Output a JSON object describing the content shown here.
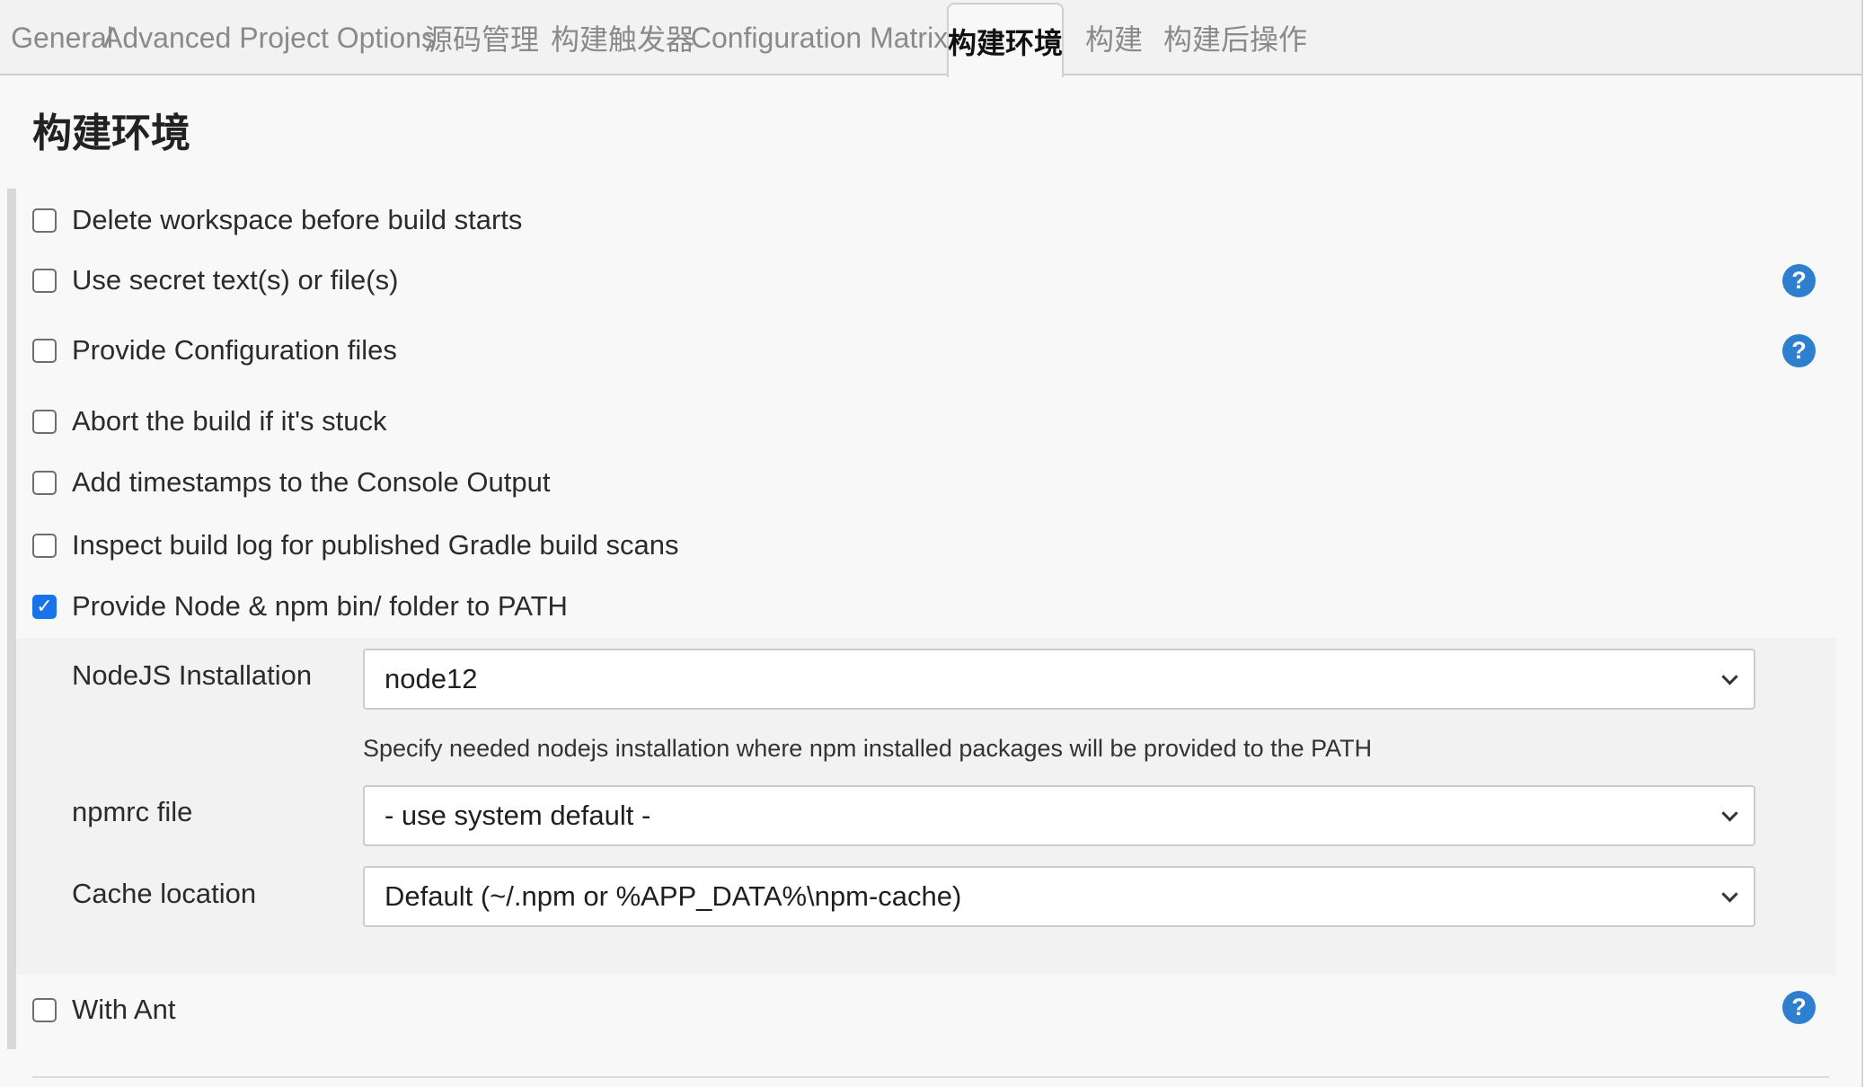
{
  "tabs": [
    {
      "label": "General"
    },
    {
      "label": "Advanced Project Options"
    },
    {
      "label": "源码管理"
    },
    {
      "label": "构建触发器"
    },
    {
      "label": "Configuration Matrix"
    },
    {
      "label": "构建环境",
      "active": true
    },
    {
      "label": "构建"
    },
    {
      "label": "构建后操作"
    }
  ],
  "section": {
    "title": "构建环境"
  },
  "options": [
    {
      "label": "Delete workspace before build starts",
      "checked": false
    },
    {
      "label": "Use secret text(s) or file(s)",
      "checked": false,
      "help": true
    },
    {
      "label": "Provide Configuration files",
      "checked": false,
      "help": true
    },
    {
      "label": "Abort the build if it's stuck",
      "checked": false
    },
    {
      "label": "Add timestamps to the Console Output",
      "checked": false
    },
    {
      "label": "Inspect build log for published Gradle build scans",
      "checked": false
    },
    {
      "label": "Provide Node & npm bin/ folder to PATH",
      "checked": true
    },
    {
      "label": "With Ant",
      "checked": false,
      "help": true
    }
  ],
  "nodejs": {
    "installation_label": "NodeJS Installation",
    "installation_value": "node12",
    "installation_hint": "Specify needed nodejs installation where npm installed packages will be provided to the PATH",
    "npmrc_label": "npmrc file",
    "npmrc_value": "- use system default -",
    "cache_label": "Cache location",
    "cache_value": "Default (~/.npm or %APP_DATA%\\npm-cache)"
  },
  "icons": {
    "help": "question-mark-help-icon",
    "dropdown": "chevron-down-icon",
    "check": "checkmark-icon"
  },
  "glyphs": {
    "help": "?",
    "check": "✓"
  },
  "colors": {
    "accent": "#1a73e8",
    "help_icon": "#2f7fd0",
    "tabbar_bg": "#f2f2f2",
    "panel_bg": "#f8f8f8"
  }
}
